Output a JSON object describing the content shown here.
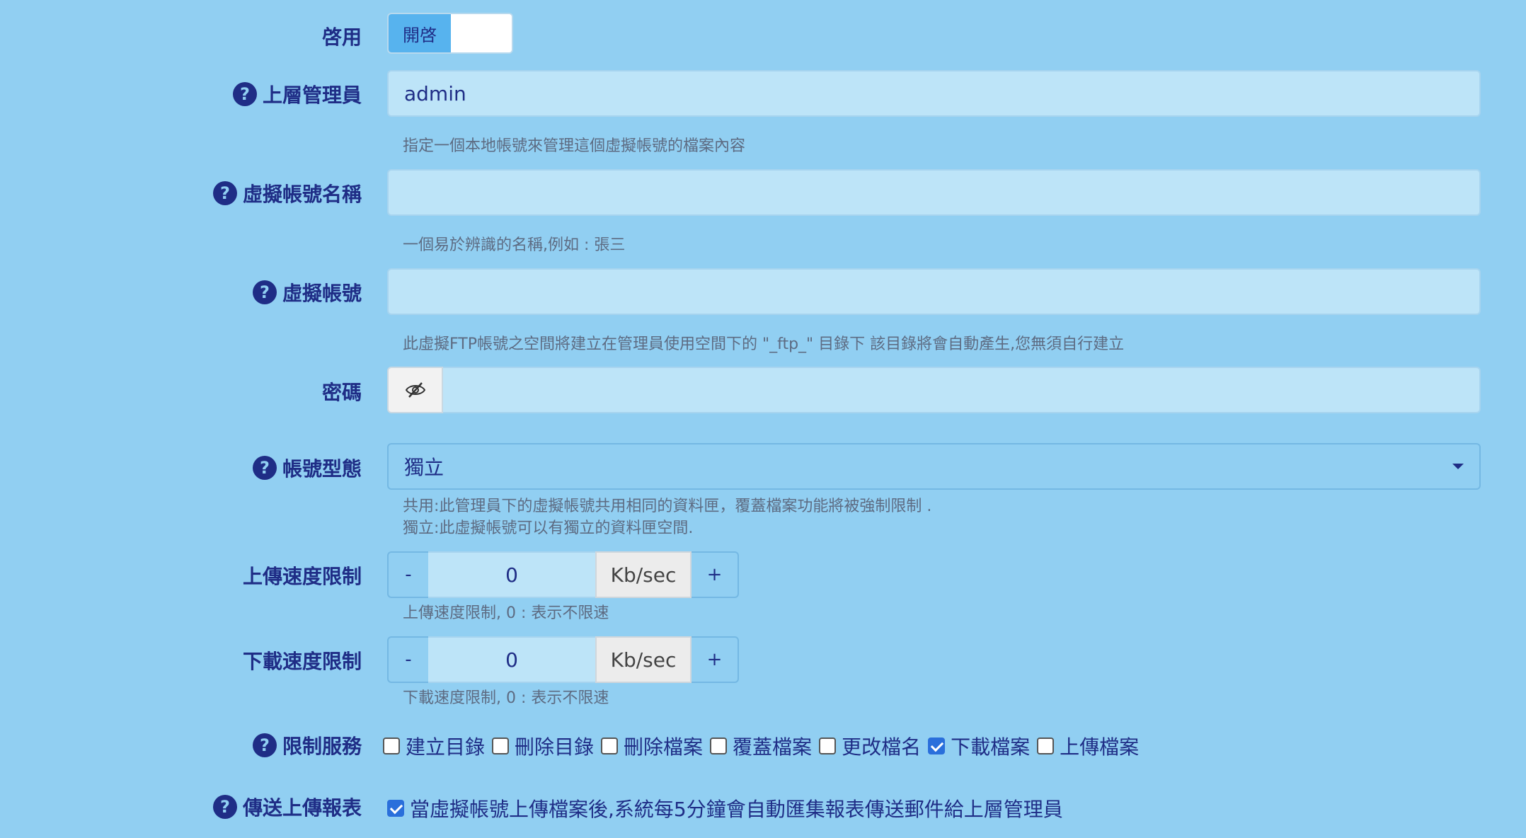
{
  "enable": {
    "label": "啓用",
    "toggle_on_text": "開啓"
  },
  "parent_admin": {
    "label": "上層管理員",
    "value": "admin",
    "hint": "指定一個本地帳號來管理這個虛擬帳號的檔案內容"
  },
  "virtual_name": {
    "label": "虛擬帳號名稱",
    "value": "",
    "hint": "一個易於辨識的名稱,例如 : 張三"
  },
  "virtual_account": {
    "label": "虛擬帳號",
    "value": "",
    "hint": "此虛擬FTP帳號之空間將建立在管理員使用空間下的 \"_ftp_\" 目錄下 該目錄將會自動產生,您無須自行建立"
  },
  "password": {
    "label": "密碼",
    "value": ""
  },
  "account_type": {
    "label": "帳號型態",
    "selected": "獨立",
    "hint_line1": "共用:此管理員下的虛擬帳號共用相同的資料匣，覆蓋檔案功能將被強制限制 .",
    "hint_line2": "獨立:此虛擬帳號可以有獨立的資料匣空間."
  },
  "upload_limit": {
    "label": "上傳速度限制",
    "minus": "-",
    "value": "0",
    "unit": "Kb/sec",
    "plus": "+",
    "hint": "上傳速度限制, 0 : 表示不限速"
  },
  "download_limit": {
    "label": "下載速度限制",
    "minus": "-",
    "value": "0",
    "unit": "Kb/sec",
    "plus": "+",
    "hint": "下載速度限制, 0 : 表示不限速"
  },
  "restrict_services": {
    "label": "限制服務",
    "options": [
      {
        "label": "建立目錄",
        "checked": false
      },
      {
        "label": "刪除目錄",
        "checked": false
      },
      {
        "label": "刪除檔案",
        "checked": false
      },
      {
        "label": "覆蓋檔案",
        "checked": false
      },
      {
        "label": "更改檔名",
        "checked": false
      },
      {
        "label": "下載檔案",
        "checked": true
      },
      {
        "label": "上傳檔案",
        "checked": false
      }
    ]
  },
  "send_report": {
    "label": "傳送上傳報表",
    "checked": true,
    "text": "當虛擬帳號上傳檔案後,系統每5分鐘會自動匯集報表傳送郵件給上層管理員"
  },
  "icons": {
    "help": "question-circle-icon",
    "password_toggle": "eye-slash-icon",
    "select_caret": "caret-down-icon"
  }
}
